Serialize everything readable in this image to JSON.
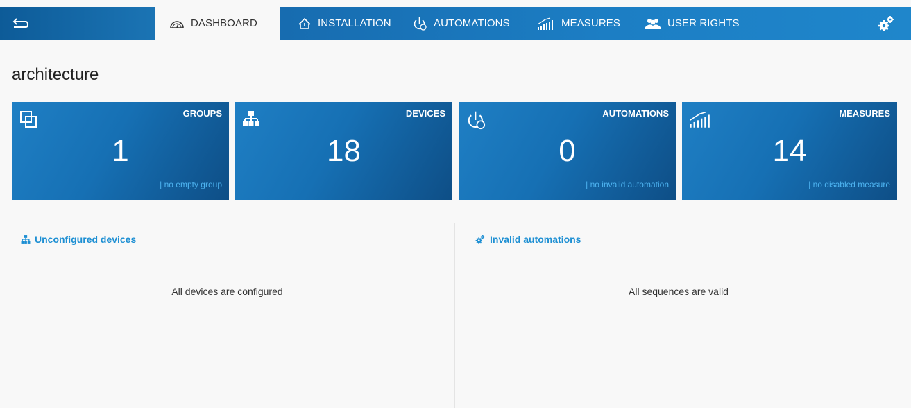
{
  "nav": {
    "back_icon": "back-arrow-icon",
    "tabs": [
      {
        "label": "DASHBOARD",
        "icon": "gauge-icon",
        "active": true
      },
      {
        "label": "INSTALLATION",
        "icon": "house-icon",
        "active": false
      },
      {
        "label": "AUTOMATIONS",
        "icon": "power-timer-icon",
        "active": false
      },
      {
        "label": "MEASURES",
        "icon": "signal-bars-icon",
        "active": false
      },
      {
        "label": "USER RIGHTS",
        "icon": "users-icon",
        "active": false
      }
    ],
    "settings_icon": "gears-icon"
  },
  "page": {
    "title": "architecture"
  },
  "cards": [
    {
      "label": "GROUPS",
      "value": "1",
      "status": "|  no empty group",
      "icon": "overlapping-squares-icon"
    },
    {
      "label": "DEVICES",
      "value": "18",
      "status": "",
      "icon": "network-tree-icon"
    },
    {
      "label": "AUTOMATIONS",
      "value": "0",
      "status": "|  no invalid automation",
      "icon": "power-timer-icon"
    },
    {
      "label": "MEASURES",
      "value": "14",
      "status": "|  no disabled measure",
      "icon": "signal-bars-icon"
    }
  ],
  "panels": {
    "unconfigured": {
      "title": "Unconfigured devices",
      "message": "All devices are configured",
      "icon": "network-tree-icon"
    },
    "invalid": {
      "title": "Invalid automations",
      "message": "All sequences are valid",
      "icon": "gears-icon"
    }
  },
  "colors": {
    "nav_dark": "#0d5b98",
    "nav_light": "#1f86cb",
    "accent": "#1d8fd3",
    "status_text": "#4db3f0"
  }
}
